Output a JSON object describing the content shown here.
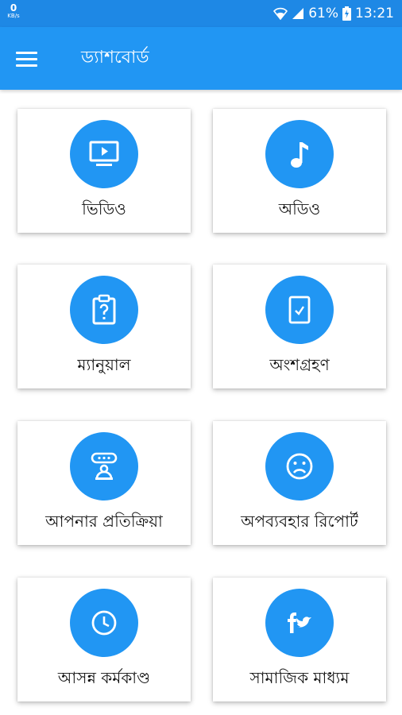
{
  "status_bar": {
    "net_speed": "0",
    "net_unit": "KB/s",
    "battery_percent": "61%",
    "time": "13:21"
  },
  "app_bar": {
    "title": "ড্যাশবোর্ড"
  },
  "tiles": [
    {
      "label": "ভিডিও",
      "icon": "tv-play-icon"
    },
    {
      "label": "অডিও",
      "icon": "music-note-icon"
    },
    {
      "label": "ম্যানুয়াল",
      "icon": "clipboard-question-icon"
    },
    {
      "label": "অংশগ্রহণ",
      "icon": "tablet-check-icon"
    },
    {
      "label": "আপনার প্রতিক্রিয়া",
      "icon": "person-speech-icon"
    },
    {
      "label": "অপব্যবহার রিপোর্ট",
      "icon": "sad-face-icon"
    },
    {
      "label": "আসন্ন কর্মকাণ্ড",
      "icon": "clock-icon"
    },
    {
      "label": "সামাজিক মাধ্যম",
      "icon": "facebook-twitter-icon"
    }
  ],
  "colors": {
    "status_bar": "#1e88e5",
    "app_bar": "#2196f3",
    "icon_circle": "#2196f3"
  }
}
